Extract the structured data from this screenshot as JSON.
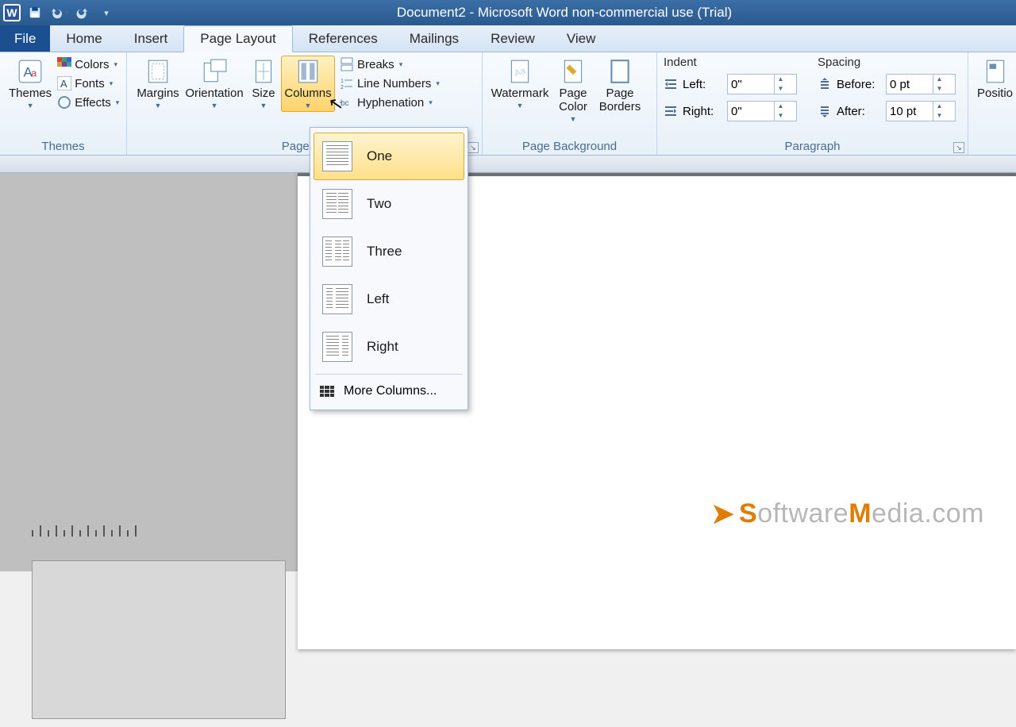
{
  "titlebar": {
    "title": "Document2  -  Microsoft Word non-commercial use (Trial)"
  },
  "tabs": {
    "file": "File",
    "items": [
      "Home",
      "Insert",
      "Page Layout",
      "References",
      "Mailings",
      "Review",
      "View"
    ],
    "active": "Page Layout"
  },
  "ribbon": {
    "themes": {
      "label": "Themes",
      "themes_btn": "Themes",
      "colors": "Colors",
      "fonts": "Fonts",
      "effects": "Effects"
    },
    "page_setup": {
      "label": "Page Se",
      "margins": "Margins",
      "orientation": "Orientation",
      "size": "Size",
      "columns": "Columns",
      "breaks": "Breaks",
      "line_numbers": "Line Numbers",
      "hyphenation": "Hyphenation"
    },
    "page_background": {
      "label": "Page Background",
      "watermark": "Watermark",
      "page_color": "Page\nColor",
      "page_borders": "Page\nBorders"
    },
    "paragraph": {
      "label": "Paragraph",
      "indent_title": "Indent",
      "spacing_title": "Spacing",
      "left_label": "Left:",
      "right_label": "Right:",
      "before_label": "Before:",
      "after_label": "After:",
      "left_val": "0\"",
      "right_val": "0\"",
      "before_val": "0 pt",
      "after_val": "10 pt"
    },
    "arrange": {
      "position": "Positio"
    }
  },
  "columns_menu": {
    "items": [
      "One",
      "Two",
      "Three",
      "Left",
      "Right"
    ],
    "more": "More Columns..."
  },
  "watermark_logo": {
    "brand1": "S",
    "brand2": "oftware",
    "brand3": "M",
    "brand4": "edia",
    "brand5": ".com"
  }
}
